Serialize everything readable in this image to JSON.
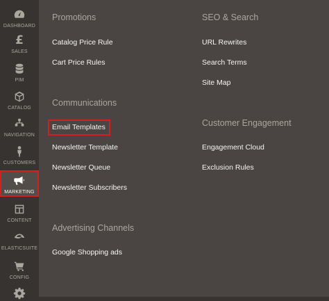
{
  "sidebar": {
    "items": [
      {
        "label": "DASHBOARD",
        "icon": "dashboard-icon"
      },
      {
        "label": "SALES",
        "icon": "pound-sign-icon"
      },
      {
        "label": "PIM",
        "icon": "database-icon"
      },
      {
        "label": "CATALOG",
        "icon": "cube-icon"
      },
      {
        "label": "NAVIGATION",
        "icon": "navigation-icon"
      },
      {
        "label": "CUSTOMERS",
        "icon": "person-icon"
      },
      {
        "label": "MARKETING",
        "icon": "megaphone-icon"
      },
      {
        "label": "CONTENT",
        "icon": "content-layout-icon"
      },
      {
        "label": "ELASTICSUITE",
        "icon": "elasticsuite-icon"
      },
      {
        "label": "CONFIG",
        "icon": "cart-icon"
      },
      {
        "label": "",
        "icon": "gear-icon"
      }
    ]
  },
  "menu": {
    "promotions": {
      "title": "Promotions",
      "links": [
        "Catalog Price Rule",
        "Cart Price Rules"
      ]
    },
    "communications": {
      "title": "Communications",
      "links": [
        "Email Templates",
        "Newsletter Template",
        "Newsletter Queue",
        "Newsletter Subscribers"
      ]
    },
    "advertising": {
      "title": "Advertising Channels",
      "links": [
        "Google Shopping ads"
      ]
    },
    "seo": {
      "title": "SEO & Search",
      "links": [
        "URL Rewrites",
        "Search Terms",
        "Site Map"
      ]
    },
    "engagement": {
      "title": "Customer Engagement",
      "links": [
        "Engagement Cloud",
        "Exclusion Rules"
      ]
    }
  },
  "colors": {
    "sidebar_bg": "#373330",
    "panel_bg": "#4a4542",
    "highlight": "#d21f1f"
  }
}
